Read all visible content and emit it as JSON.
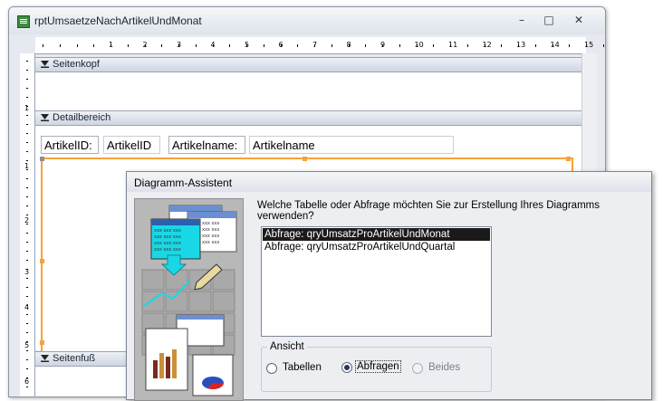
{
  "window": {
    "title": "rptUmsaetzeNachArtikelUndMonat",
    "icon": "report-icon",
    "controls": [
      "minimize-icon",
      "maximize-icon",
      "close-icon"
    ]
  },
  "ruler": {
    "horizontal_numbers": [
      "1",
      "2",
      "3",
      "4",
      "5",
      "6",
      "7",
      "8",
      "9",
      "10",
      "11",
      "12",
      "13",
      "14",
      "15",
      "16"
    ],
    "vertical_numbers": [
      "1",
      "1",
      "2",
      "3",
      "4",
      "5",
      "6"
    ]
  },
  "sections": {
    "page_header": "Seitenkopf",
    "detail": "Detailbereich",
    "page_footer": "Seitenfuß"
  },
  "detail_fields": [
    {
      "label": "ArtikelID:",
      "control": "ArtikelID"
    },
    {
      "label": "Artikelname:",
      "control": "Artikelname"
    }
  ],
  "dialog": {
    "title": "Diagramm-Assistent",
    "question": "Welche Tabelle oder Abfrage möchten Sie zur Erstellung Ihres Diagramms verwenden?",
    "list_items": [
      {
        "label": "Abfrage: qryUmsatzProArtikelUndMonat",
        "selected": true
      },
      {
        "label": "Abfrage: qryUmsatzProArtikelUndQuartal",
        "selected": false
      }
    ],
    "view_group": {
      "legend": "Ansicht",
      "options": [
        {
          "label": "Tabellen",
          "checked": false,
          "enabled": true
        },
        {
          "label": "Abfragen",
          "checked": true,
          "enabled": true
        },
        {
          "label": "Beides",
          "checked": false,
          "enabled": false
        }
      ]
    }
  },
  "colors": {
    "selection_border": "#f5a33a",
    "list_selected_bg": "#1a1a1a",
    "illustration_cyan": "#19d8e6"
  }
}
